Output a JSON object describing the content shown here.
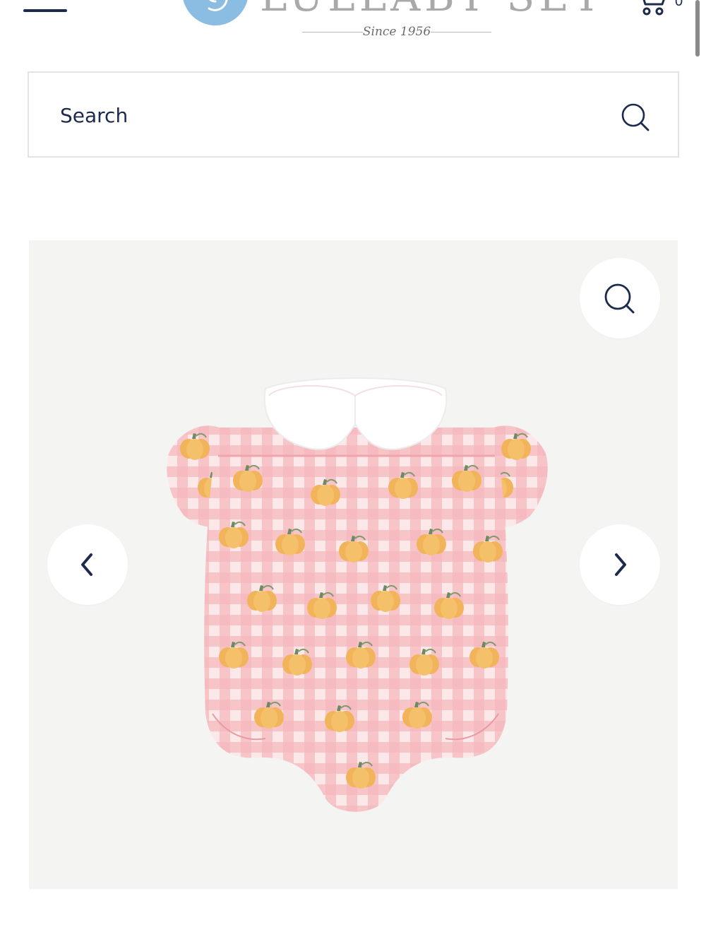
{
  "header": {
    "logo_text": "LULLABY SET",
    "tagline": "Since 1956",
    "cart_count": "0"
  },
  "search": {
    "placeholder": "Search"
  },
  "gallery": {
    "image_alt": "Pink gingham pumpkin print bubble romper with white Peter Pan collar",
    "bg_color": "#f4f4f3"
  },
  "colors": {
    "navy": "#1c2a4d",
    "logo_blue": "#8bbde3",
    "gingham_pink": "#f2a7ae",
    "pumpkin_orange": "#f2b45a"
  },
  "icons": [
    "menu-icon",
    "cart-icon",
    "search-icon",
    "zoom-icon",
    "chevron-left-icon",
    "chevron-right-icon"
  ]
}
